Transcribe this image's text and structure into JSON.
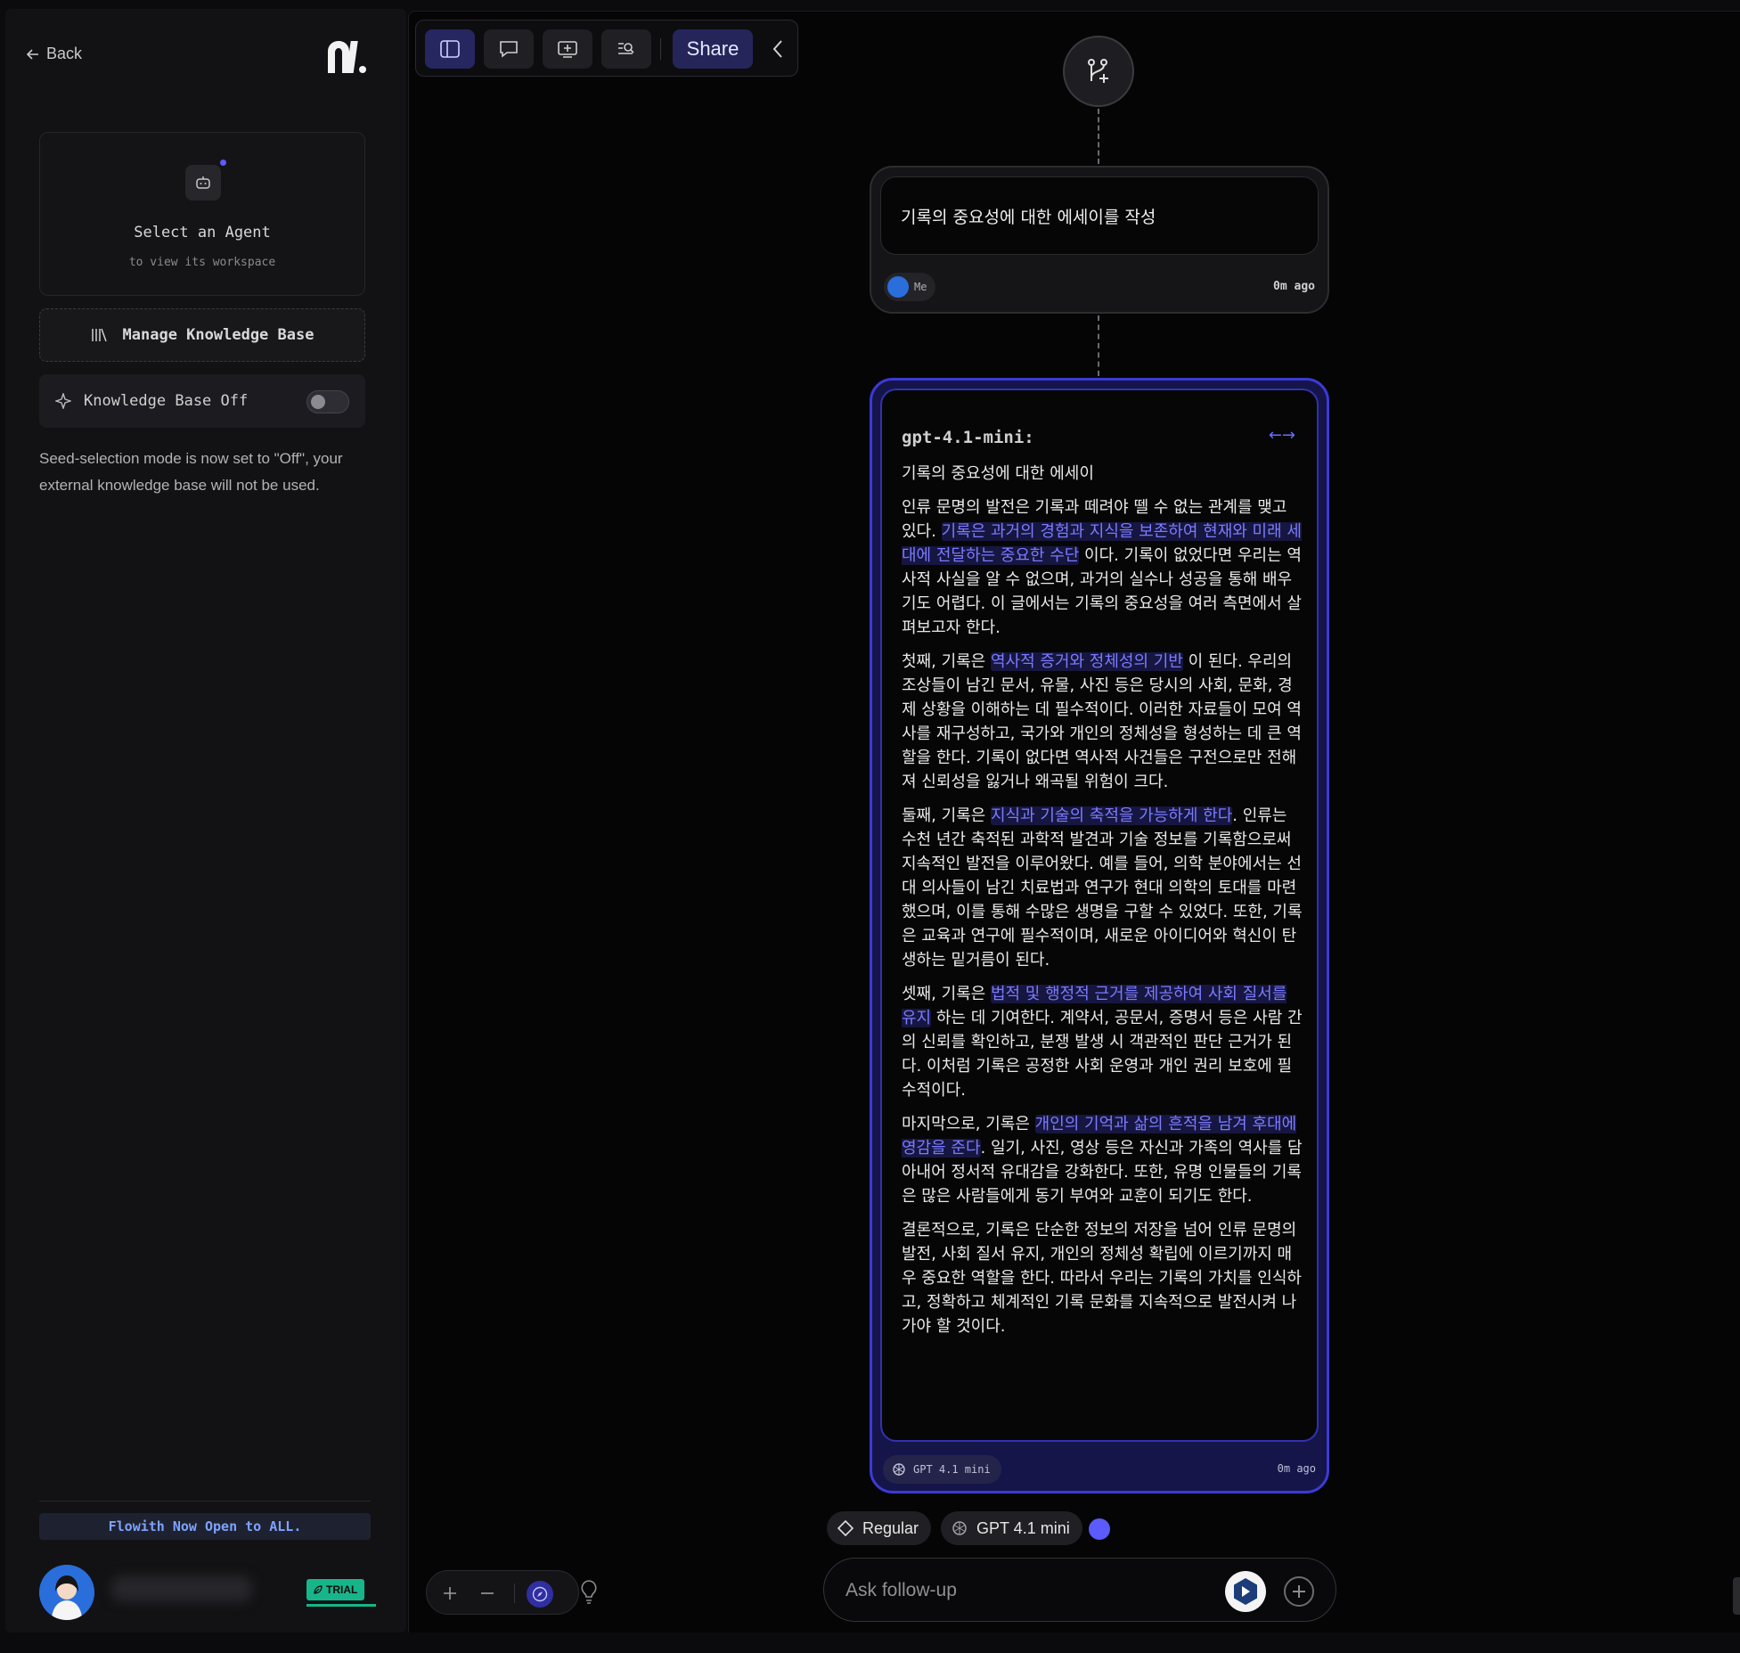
{
  "sidebar": {
    "back_label": "Back",
    "agent_card": {
      "title": "Select an Agent",
      "subtitle": "to view its workspace"
    },
    "manage_kb_label": "Manage Knowledge Base",
    "kb_toggle_label": "Knowledge Base Off",
    "kb_toggle_on": false,
    "kb_note": "Seed-selection mode is now set to \"Off\", your external knowledge base will not be used.",
    "promo": "Flowith Now Open to ALL.",
    "trial_badge": "TRIAL"
  },
  "toolbar": {
    "buttons": [
      "sidebar-icon",
      "chat-icon",
      "add-frame-icon",
      "search-list-icon"
    ],
    "share_label": "Share"
  },
  "question": {
    "text": "기록의 중요성에 대한 에세이를 작성",
    "author": "Me",
    "time": "0m ago"
  },
  "answer": {
    "model_header": "gpt-4.1-mini:",
    "title": "기록의 중요성에 대한 에세이",
    "paragraphs": [
      [
        "인류 문명의 발전은 기록과 떼려야 뗄 수 없는 관계를 맺고 있다. ",
        {
          "hl": "기록은 과거의 경험과 지식을 보존하여 현재와 미래 세대에 전달하는 중요한 수단"
        },
        " 이다. 기록이 없었다면 우리는 역사적 사실을 알 수 없으며, 과거의 실수나 성공을 통해 배우기도 어렵다. 이 글에서는 기록의 중요성을 여러 측면에서 살펴보고자 한다."
      ],
      [
        "첫째, 기록은 ",
        {
          "hl": "역사적 증거와 정체성의 기반"
        },
        " 이 된다. 우리의 조상들이 남긴 문서, 유물, 사진 등은 당시의 사회, 문화, 경제 상황을 이해하는 데 필수적이다. 이러한 자료들이 모여 역사를 재구성하고, 국가와 개인의 정체성을 형성하는 데 큰 역할을 한다. 기록이 없다면 역사적 사건들은 구전으로만 전해져 신뢰성을 잃거나 왜곡될 위험이 크다."
      ],
      [
        "둘째, 기록은 ",
        {
          "hl": "지식과 기술의 축적을 가능하게 한다"
        },
        ". 인류는 수천 년간 축적된 과학적 발견과 기술 정보를 기록함으로써 지속적인 발전을 이루어왔다. 예를 들어, 의학 분야에서는 선대 의사들이 남긴 치료법과 연구가 현대 의학의 토대를 마련했으며, 이를 통해 수많은 생명을 구할 수 있었다. 또한, 기록은 교육과 연구에 필수적이며, 새로운 아이디어와 혁신이 탄생하는 밑거름이 된다."
      ],
      [
        "셋째, 기록은 ",
        {
          "hl": "법적 및 행정적 근거를 제공하여 사회 질서를 유지"
        },
        " 하는 데 기여한다. 계약서, 공문서, 증명서 등은 사람 간의 신뢰를 확인하고, 분쟁 발생 시 객관적인 판단 근거가 된다. 이처럼 기록은 공정한 사회 운영과 개인 권리 보호에 필수적이다."
      ],
      [
        "마지막으로, 기록은 ",
        {
          "hl": "개인의 기억과 삶의 흔적을 남겨 후대에 영감을 준다"
        },
        ". 일기, 사진, 영상 등은 자신과 가족의 역사를 담아내어 정서적 유대감을 강화한다. 또한, 유명 인물들의 기록은 많은 사람들에게 동기 부여와 교훈이 되기도 한다."
      ],
      [
        "결론적으로, 기록은 단순한 정보의 저장을 넘어 인류 문명의 발전, 사회 질서 유지, 개인의 정체성 확립에 이르기까지 매우 중요한 역할을 한다. 따라서 우리는 기록의 가치를 인식하고, 정확하고 체계적인 기록 문화를 지속적으로 발전시켜 나가야 할 것이다."
      ]
    ],
    "model_chip": "GPT 4.1 mini",
    "time": "0m ago"
  },
  "composer": {
    "mode_label": "Regular",
    "model_label": "GPT 4.1 mini",
    "placeholder": "Ask follow-up"
  },
  "colors": {
    "accent": "#5b5bff",
    "highlight_text": "#7b7bff",
    "answer_border": "#3b3bd6",
    "trial_green": "#18b58a"
  }
}
